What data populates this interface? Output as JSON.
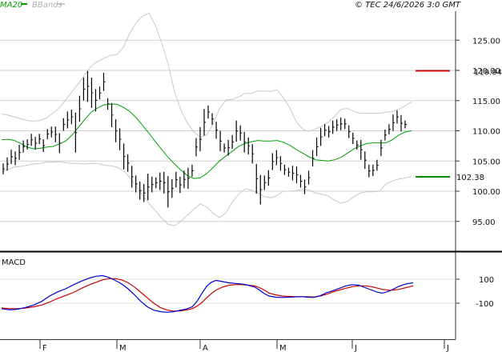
{
  "header": {
    "legend_ma": "MA20",
    "legend_bb": "BBands",
    "copyright": "© TEC 24/6/2026 3:0 GMT"
  },
  "colors": {
    "ma": "#00a000",
    "bbands": "#c8c8c8",
    "price": "#000000",
    "macd": "#0000cc",
    "signal": "#cc0000",
    "resistance": "#cc0000",
    "support": "#008800",
    "grid": "#d0d0d0"
  },
  "price_panel": {
    "y_ticks": [
      "125.00",
      "120.00",
      "115.00",
      "110.00",
      "105.00",
      "100.00",
      "95.00"
    ],
    "resistance_label": "119.94",
    "support_label": "102.38"
  },
  "macd_panel": {
    "title": "MACD",
    "y_ticks": [
      "100",
      "-100"
    ]
  },
  "x_axis": {
    "months": [
      "F",
      "M",
      "A",
      "M",
      "J",
      "J"
    ]
  },
  "chart_data": {
    "type": "line",
    "ylim_price": [
      90.5,
      131
    ],
    "price_ticks": [
      125,
      120,
      115,
      110,
      105,
      100,
      95
    ],
    "levels": {
      "resistance": 119.94,
      "support": 102.38
    },
    "bars": [
      [
        104.6,
        102.8
      ],
      [
        105.6,
        103.4
      ],
      [
        106.9,
        104.5
      ],
      [
        106.6,
        104.3
      ],
      [
        107.7,
        105.2
      ],
      [
        108.4,
        106.4
      ],
      [
        108.6,
        106.9
      ],
      [
        109.5,
        107.5
      ],
      [
        109.0,
        106.9
      ],
      [
        109.5,
        107.8
      ],
      [
        108.6,
        106.5
      ],
      [
        110.3,
        108.6
      ],
      [
        110.7,
        108.9
      ],
      [
        110.7,
        108.1
      ],
      [
        109.6,
        106.3
      ],
      [
        112.1,
        110.0
      ],
      [
        113.2,
        110.4
      ],
      [
        113.5,
        111.1
      ],
      [
        113.0,
        106.4
      ],
      [
        115.8,
        111.5
      ],
      [
        118.8,
        115.0
      ],
      [
        119.9,
        114.8
      ],
      [
        118.8,
        113.8
      ],
      [
        116.9,
        113.2
      ],
      [
        117.3,
        115.2
      ],
      [
        119.6,
        116.6
      ],
      [
        115.4,
        113.5
      ],
      [
        114.6,
        110.6
      ],
      [
        111.9,
        108.1
      ],
      [
        110.4,
        106.8
      ],
      [
        107.9,
        103.6
      ],
      [
        106.1,
        103.2
      ],
      [
        104.2,
        100.6
      ],
      [
        102.6,
        99.8
      ],
      [
        101.6,
        98.6
      ],
      [
        101.2,
        98.2
      ],
      [
        102.9,
        98.5
      ],
      [
        102.4,
        99.8
      ],
      [
        102.3,
        100.5
      ],
      [
        103.1,
        100.2
      ],
      [
        103.2,
        99.6
      ],
      [
        102.5,
        97.3
      ],
      [
        102.0,
        98.9
      ],
      [
        103.2,
        100.6
      ],
      [
        102.4,
        99.7
      ],
      [
        103.4,
        100.5
      ],
      [
        103.9,
        100.4
      ],
      [
        104.4,
        102.4
      ],
      [
        108.8,
        105.8
      ],
      [
        110.6,
        106.6
      ],
      [
        113.6,
        109.2
      ],
      [
        114.2,
        112.0
      ],
      [
        112.9,
        111.0
      ],
      [
        111.5,
        108.7
      ],
      [
        110.0,
        106.6
      ],
      [
        107.9,
        106.4
      ],
      [
        108.5,
        105.9
      ],
      [
        109.3,
        107.0
      ],
      [
        111.7,
        108.2
      ],
      [
        110.9,
        108.4
      ],
      [
        109.8,
        106.4
      ],
      [
        108.9,
        106.1
      ],
      [
        107.8,
        104.6
      ],
      [
        104.5,
        99.6
      ],
      [
        102.7,
        97.8
      ],
      [
        102.6,
        100.2
      ],
      [
        103.5,
        100.9
      ],
      [
        106.3,
        103.5
      ],
      [
        106.8,
        104.3
      ],
      [
        105.8,
        103.4
      ],
      [
        104.4,
        102.7
      ],
      [
        103.9,
        102.4
      ],
      [
        104.2,
        101.8
      ],
      [
        104.1,
        101.3
      ],
      [
        102.7,
        100.6
      ],
      [
        101.9,
        99.5
      ],
      [
        103.4,
        101.1
      ],
      [
        106.8,
        104.1
      ],
      [
        108.9,
        105.8
      ],
      [
        110.5,
        107.5
      ],
      [
        111.1,
        109.1
      ],
      [
        110.8,
        108.9
      ],
      [
        111.7,
        109.5
      ],
      [
        111.9,
        110.0
      ],
      [
        112.2,
        110.1
      ],
      [
        112.0,
        110.3
      ],
      [
        110.9,
        108.8
      ],
      [
        109.7,
        107.8
      ],
      [
        108.4,
        106.9
      ],
      [
        108.5,
        105.2
      ],
      [
        106.6,
        103.7
      ],
      [
        104.4,
        102.3
      ],
      [
        104.4,
        102.5
      ],
      [
        105.2,
        103.4
      ],
      [
        108.5,
        105.8
      ],
      [
        110.2,
        108.4
      ],
      [
        111.1,
        109.4
      ],
      [
        112.7,
        110.0
      ],
      [
        113.4,
        111.2
      ],
      [
        112.6,
        109.9
      ],
      [
        111.7,
        110.4
      ]
    ],
    "ma20": [
      [
        0,
        108.5
      ],
      [
        8,
        108.6
      ],
      [
        16,
        108.4
      ],
      [
        24,
        107.9
      ],
      [
        32,
        107.3
      ],
      [
        40,
        107.0
      ],
      [
        48,
        107.1
      ],
      [
        56,
        107.3
      ],
      [
        64,
        107.4
      ],
      [
        72,
        107.8
      ],
      [
        80,
        108.3
      ],
      [
        88,
        109.3
      ],
      [
        96,
        110.6
      ],
      [
        104,
        111.9
      ],
      [
        112,
        113.1
      ],
      [
        120,
        113.8
      ],
      [
        128,
        114.3
      ],
      [
        136,
        114.4
      ],
      [
        144,
        114.4
      ],
      [
        152,
        113.9
      ],
      [
        160,
        113.2
      ],
      [
        168,
        112.2
      ],
      [
        176,
        110.9
      ],
      [
        184,
        109.6
      ],
      [
        192,
        108.2
      ],
      [
        200,
        106.9
      ],
      [
        208,
        105.6
      ],
      [
        216,
        104.5
      ],
      [
        224,
        103.5
      ],
      [
        232,
        102.6
      ],
      [
        240,
        102.1
      ],
      [
        248,
        102.2
      ],
      [
        256,
        102.9
      ],
      [
        264,
        103.9
      ],
      [
        272,
        105.0
      ],
      [
        280,
        105.8
      ],
      [
        288,
        106.6
      ],
      [
        296,
        107.4
      ],
      [
        304,
        107.9
      ],
      [
        312,
        108.2
      ],
      [
        320,
        108.4
      ],
      [
        328,
        108.3
      ],
      [
        336,
        108.3
      ],
      [
        344,
        108.4
      ],
      [
        352,
        108.1
      ],
      [
        360,
        107.6
      ],
      [
        368,
        106.9
      ],
      [
        376,
        106.3
      ],
      [
        384,
        105.7
      ],
      [
        392,
        105.2
      ],
      [
        400,
        105.1
      ],
      [
        408,
        105.0
      ],
      [
        416,
        105.2
      ],
      [
        424,
        105.6
      ],
      [
        432,
        106.3
      ],
      [
        440,
        107.0
      ],
      [
        448,
        107.5
      ],
      [
        456,
        107.9
      ],
      [
        464,
        108.0
      ],
      [
        472,
        108.0
      ],
      [
        480,
        108.0
      ],
      [
        488,
        108.5
      ],
      [
        496,
        109.3
      ],
      [
        504,
        109.8
      ],
      [
        512,
        110.0
      ]
    ],
    "bb_upper": [
      [
        0,
        112.8
      ],
      [
        8,
        112.6
      ],
      [
        16,
        112.3
      ],
      [
        24,
        112.0
      ],
      [
        32,
        111.7
      ],
      [
        40,
        111.6
      ],
      [
        48,
        111.7
      ],
      [
        56,
        112.1
      ],
      [
        64,
        112.9
      ],
      [
        72,
        113.8
      ],
      [
        80,
        115.1
      ],
      [
        88,
        116.5
      ],
      [
        96,
        117.8
      ],
      [
        104,
        119.3
      ],
      [
        112,
        120.7
      ],
      [
        120,
        121.5
      ],
      [
        128,
        122.0
      ],
      [
        136,
        122.5
      ],
      [
        144,
        122.6
      ],
      [
        152,
        123.8
      ],
      [
        160,
        126.1
      ],
      [
        168,
        127.9
      ],
      [
        176,
        129.0
      ],
      [
        184,
        129.5
      ],
      [
        192,
        127.5
      ],
      [
        200,
        124.5
      ],
      [
        208,
        121.0
      ],
      [
        216,
        116.5
      ],
      [
        224,
        113.4
      ],
      [
        232,
        111.3
      ],
      [
        240,
        109.8
      ],
      [
        248,
        109.0
      ],
      [
        256,
        109.3
      ],
      [
        264,
        111.1
      ],
      [
        272,
        113.6
      ],
      [
        280,
        115.1
      ],
      [
        288,
        115.2
      ],
      [
        296,
        115.6
      ],
      [
        304,
        116.2
      ],
      [
        312,
        116.2
      ],
      [
        320,
        116.6
      ],
      [
        328,
        116.6
      ],
      [
        336,
        116.5
      ],
      [
        344,
        116.8
      ],
      [
        352,
        115.5
      ],
      [
        360,
        113.8
      ],
      [
        368,
        111.5
      ],
      [
        376,
        110.3
      ],
      [
        384,
        109.9
      ],
      [
        392,
        110.3
      ],
      [
        400,
        110.8
      ],
      [
        408,
        111.4
      ],
      [
        416,
        112.4
      ],
      [
        424,
        113.6
      ],
      [
        432,
        113.7
      ],
      [
        440,
        113.2
      ],
      [
        448,
        112.9
      ],
      [
        456,
        112.9
      ],
      [
        464,
        112.9
      ],
      [
        472,
        112.9
      ],
      [
        480,
        113.1
      ],
      [
        488,
        113.2
      ],
      [
        496,
        113.6
      ],
      [
        504,
        114.1
      ],
      [
        512,
        114.8
      ]
    ],
    "bb_lower": [
      [
        0,
        103.2
      ],
      [
        8,
        103.6
      ],
      [
        16,
        104.0
      ],
      [
        24,
        104.1
      ],
      [
        32,
        104.3
      ],
      [
        40,
        104.5
      ],
      [
        48,
        104.6
      ],
      [
        56,
        104.8
      ],
      [
        64,
        104.8
      ],
      [
        72,
        104.9
      ],
      [
        80,
        104.7
      ],
      [
        88,
        104.6
      ],
      [
        96,
        104.6
      ],
      [
        104,
        104.5
      ],
      [
        112,
        104.6
      ],
      [
        120,
        104.6
      ],
      [
        128,
        104.3
      ],
      [
        136,
        104.2
      ],
      [
        144,
        104.0
      ],
      [
        152,
        103.4
      ],
      [
        160,
        102.3
      ],
      [
        168,
        100.9
      ],
      [
        176,
        99.3
      ],
      [
        184,
        98.0
      ],
      [
        192,
        96.8
      ],
      [
        200,
        95.5
      ],
      [
        208,
        94.5
      ],
      [
        216,
        94.3
      ],
      [
        224,
        95.0
      ],
      [
        232,
        96.0
      ],
      [
        240,
        97.0
      ],
      [
        248,
        97.9
      ],
      [
        256,
        97.4
      ],
      [
        264,
        96.4
      ],
      [
        272,
        95.6
      ],
      [
        280,
        96.4
      ],
      [
        288,
        98.2
      ],
      [
        296,
        99.5
      ],
      [
        304,
        100.4
      ],
      [
        312,
        100.2
      ],
      [
        320,
        99.7
      ],
      [
        328,
        99.1
      ],
      [
        336,
        98.9
      ],
      [
        344,
        99.3
      ],
      [
        352,
        100.0
      ],
      [
        360,
        100.0
      ],
      [
        368,
        100.1
      ],
      [
        376,
        100.3
      ],
      [
        384,
        100.2
      ],
      [
        392,
        99.7
      ],
      [
        400,
        99.5
      ],
      [
        408,
        99.2
      ],
      [
        416,
        98.5
      ],
      [
        424,
        98.0
      ],
      [
        432,
        98.3
      ],
      [
        440,
        99.1
      ],
      [
        448,
        99.7
      ],
      [
        456,
        99.9
      ],
      [
        464,
        99.9
      ],
      [
        472,
        100.0
      ],
      [
        480,
        101.2
      ],
      [
        488,
        101.7
      ],
      [
        496,
        102.0
      ],
      [
        504,
        102.2
      ],
      [
        512,
        102.4
      ]
    ],
    "macd_ticks": [
      100,
      -100
    ],
    "macd_ylim": [
      -220,
      195
    ],
    "macd": [
      [
        0,
        -145
      ],
      [
        10,
        -155
      ],
      [
        20,
        -150
      ],
      [
        30,
        -135
      ],
      [
        40,
        -115
      ],
      [
        50,
        -85
      ],
      [
        60,
        -40
      ],
      [
        70,
        -5
      ],
      [
        80,
        20
      ],
      [
        90,
        55
      ],
      [
        100,
        85
      ],
      [
        110,
        110
      ],
      [
        118,
        125
      ],
      [
        126,
        130
      ],
      [
        134,
        115
      ],
      [
        142,
        90
      ],
      [
        150,
        60
      ],
      [
        158,
        20
      ],
      [
        166,
        -30
      ],
      [
        174,
        -85
      ],
      [
        182,
        -130
      ],
      [
        190,
        -158
      ],
      [
        198,
        -170
      ],
      [
        206,
        -175
      ],
      [
        214,
        -172
      ],
      [
        222,
        -160
      ],
      [
        230,
        -150
      ],
      [
        238,
        -130
      ],
      [
        244,
        -85
      ],
      [
        250,
        -20
      ],
      [
        256,
        40
      ],
      [
        262,
        75
      ],
      [
        268,
        90
      ],
      [
        276,
        80
      ],
      [
        284,
        70
      ],
      [
        292,
        65
      ],
      [
        300,
        60
      ],
      [
        308,
        50
      ],
      [
        316,
        35
      ],
      [
        322,
        10
      ],
      [
        328,
        -20
      ],
      [
        334,
        -40
      ],
      [
        342,
        -50
      ],
      [
        350,
        -52
      ],
      [
        358,
        -50
      ],
      [
        366,
        -48
      ],
      [
        374,
        -45
      ],
      [
        382,
        -50
      ],
      [
        390,
        -52
      ],
      [
        398,
        -38
      ],
      [
        406,
        -12
      ],
      [
        414,
        5
      ],
      [
        422,
        25
      ],
      [
        430,
        45
      ],
      [
        438,
        55
      ],
      [
        446,
        50
      ],
      [
        454,
        30
      ],
      [
        462,
        10
      ],
      [
        470,
        -10
      ],
      [
        476,
        -15
      ],
      [
        484,
        0
      ],
      [
        490,
        20
      ],
      [
        496,
        40
      ],
      [
        502,
        55
      ],
      [
        508,
        65
      ],
      [
        514,
        70
      ]
    ],
    "signal": [
      [
        0,
        -140
      ],
      [
        10,
        -145
      ],
      [
        20,
        -145
      ],
      [
        30,
        -140
      ],
      [
        40,
        -130
      ],
      [
        50,
        -115
      ],
      [
        60,
        -90
      ],
      [
        70,
        -60
      ],
      [
        80,
        -35
      ],
      [
        90,
        -10
      ],
      [
        100,
        25
      ],
      [
        110,
        55
      ],
      [
        118,
        75
      ],
      [
        126,
        95
      ],
      [
        134,
        105
      ],
      [
        142,
        105
      ],
      [
        150,
        95
      ],
      [
        158,
        70
      ],
      [
        166,
        35
      ],
      [
        174,
        -10
      ],
      [
        182,
        -55
      ],
      [
        190,
        -100
      ],
      [
        198,
        -135
      ],
      [
        206,
        -155
      ],
      [
        214,
        -165
      ],
      [
        222,
        -165
      ],
      [
        230,
        -158
      ],
      [
        238,
        -145
      ],
      [
        244,
        -125
      ],
      [
        250,
        -95
      ],
      [
        256,
        -55
      ],
      [
        262,
        -20
      ],
      [
        268,
        10
      ],
      [
        276,
        35
      ],
      [
        284,
        50
      ],
      [
        292,
        55
      ],
      [
        300,
        55
      ],
      [
        308,
        50
      ],
      [
        316,
        45
      ],
      [
        322,
        30
      ],
      [
        328,
        10
      ],
      [
        334,
        -15
      ],
      [
        342,
        -30
      ],
      [
        350,
        -40
      ],
      [
        358,
        -42
      ],
      [
        366,
        -45
      ],
      [
        374,
        -45
      ],
      [
        382,
        -45
      ],
      [
        390,
        -48
      ],
      [
        398,
        -40
      ],
      [
        406,
        -25
      ],
      [
        414,
        -5
      ],
      [
        422,
        10
      ],
      [
        430,
        25
      ],
      [
        438,
        38
      ],
      [
        446,
        45
      ],
      [
        454,
        45
      ],
      [
        462,
        38
      ],
      [
        470,
        25
      ],
      [
        476,
        15
      ],
      [
        484,
        8
      ],
      [
        490,
        10
      ],
      [
        496,
        15
      ],
      [
        502,
        25
      ],
      [
        508,
        35
      ],
      [
        514,
        45
      ]
    ]
  }
}
